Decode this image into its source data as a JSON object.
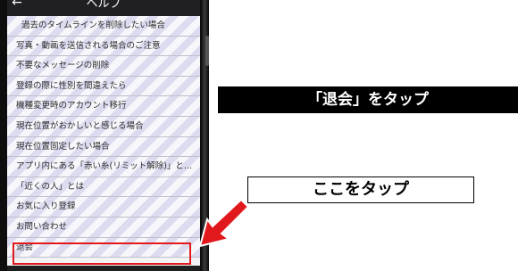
{
  "navbar": {
    "title": "ヘルプ"
  },
  "help_items": [
    "過去のタイムラインを削除したい場合",
    "写真・動画を送信される場合のご注意",
    "不要なメッセージの削除",
    "登録の際に性別を間違えたら",
    "機種変更時のアカウント移行",
    "現在位置がおかしいと感じる場合",
    "現在位置固定したい場合",
    "アプリ内にある「赤い糸(リミット解除)」と...",
    "「近くの人」とは",
    "お気に入り登録",
    "お問い合わせ",
    "退会"
  ],
  "callouts": {
    "top": "「退会」をタップ",
    "bottom": "ここをタップ"
  },
  "colors": {
    "highlight": "#e2191c",
    "callout_black": "#000000"
  }
}
